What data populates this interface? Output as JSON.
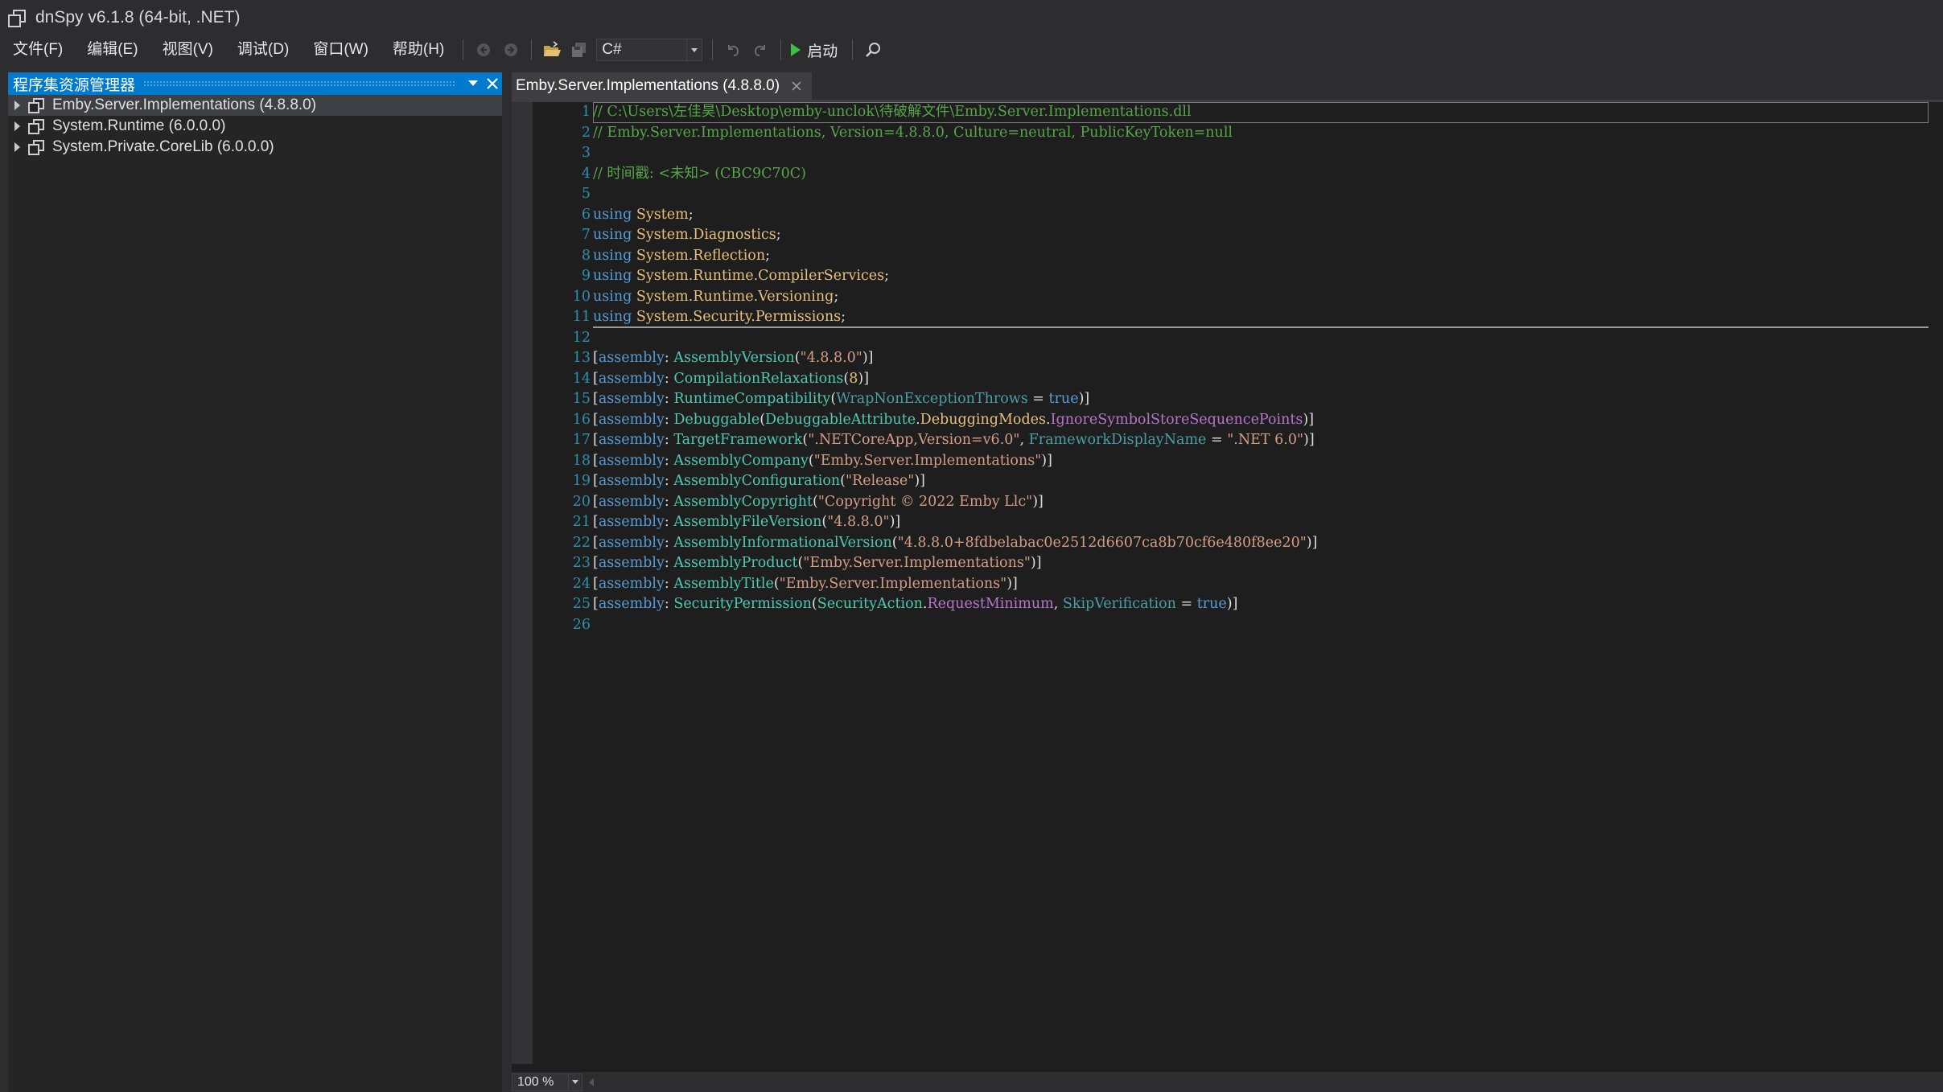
{
  "window": {
    "title": "dnSpy v6.1.8 (64-bit, .NET)"
  },
  "menu": {
    "items": [
      "文件(F)",
      "编辑(E)",
      "视图(V)",
      "调试(D)",
      "窗口(W)",
      "帮助(H)"
    ]
  },
  "toolbar": {
    "language": "C#",
    "start_label": "启动"
  },
  "assembly_explorer": {
    "title": "程序集资源管理器",
    "items": [
      {
        "name": "Emby.Server.Implementations",
        "version": "(4.8.8.0)",
        "selected": true
      },
      {
        "name": "System.Runtime",
        "version": "(6.0.0.0)",
        "selected": false
      },
      {
        "name": "System.Private.CoreLib",
        "version": "(6.0.0.0)",
        "selected": false
      }
    ]
  },
  "editor": {
    "tab_label": "Emby.Server.Implementations (4.8.8.0)",
    "line_numbers": [
      "1",
      "2",
      "3",
      "4",
      "5",
      "6",
      "7",
      "8",
      "9",
      "10",
      "11",
      "12",
      "13",
      "14",
      "15",
      "16",
      "17",
      "18",
      "19",
      "20",
      "21",
      "22",
      "23",
      "24",
      "25",
      "26"
    ],
    "code": {
      "l1": "// C:\\Users\\左佳昊\\Desktop\\emby-unclok\\待破解文件\\Emby.Server.Implementations.dll",
      "l2": "// Emby.Server.Implementations, Version=4.8.8.0, Culture=neutral, PublicKeyToken=null",
      "l4": "// 时间戳: <未知> (CBC9C70C)",
      "using_kw": "using",
      "u6": "System",
      "u7": "System.Diagnostics",
      "u8": "System.Reflection",
      "u9": "System.Runtime.CompilerServices",
      "u10": "System.Runtime.Versioning",
      "u11": "System.Security.Permissions",
      "assembly_kw": "assembly",
      "a13_attr": "AssemblyVersion",
      "a13_val": "\"4.8.8.0\"",
      "a14_attr": "CompilationRelaxations",
      "a14_val": "8",
      "a15_attr": "RuntimeCompatibility",
      "a15_prop": "WrapNonExceptionThrows",
      "a15_val": "true",
      "a16_attr": "Debuggable",
      "a16_type": "DebuggableAttribute",
      "a16_type2": "DebuggingModes",
      "a16_enum": "IgnoreSymbolStoreSequencePoints",
      "a17_attr": "TargetFramework",
      "a17_val": "\".NETCoreApp,Version=v6.0\"",
      "a17_prop": "FrameworkDisplayName",
      "a17_val2": "\".NET 6.0\"",
      "a18_attr": "AssemblyCompany",
      "a18_val": "\"Emby.Server.Implementations\"",
      "a19_attr": "AssemblyConfiguration",
      "a19_val": "\"Release\"",
      "a20_attr": "AssemblyCopyright",
      "a20_val": "\"Copyright © 2022 Emby Llc\"",
      "a21_attr": "AssemblyFileVersion",
      "a21_val": "\"4.8.8.0\"",
      "a22_attr": "AssemblyInformationalVersion",
      "a22_val": "\"4.8.8.0+8fdbelabac0e2512d6607ca8b70cf6e480f8ee20\"",
      "a23_attr": "AssemblyProduct",
      "a23_val": "\"Emby.Server.Implementations\"",
      "a24_attr": "AssemblyTitle",
      "a24_val": "\"Emby.Server.Implementations\"",
      "a25_attr": "SecurityPermission",
      "a25_type": "SecurityAction",
      "a25_enum": "RequestMinimum",
      "a25_prop": "SkipVerification",
      "a25_val": "true"
    },
    "zoom": "100 %"
  },
  "colors": {
    "accent": "#007acc",
    "background": "#1e1e1e",
    "comment": "#57a64a",
    "keyword": "#569cd6",
    "string": "#d69d85",
    "type": "#4ec9b0"
  }
}
